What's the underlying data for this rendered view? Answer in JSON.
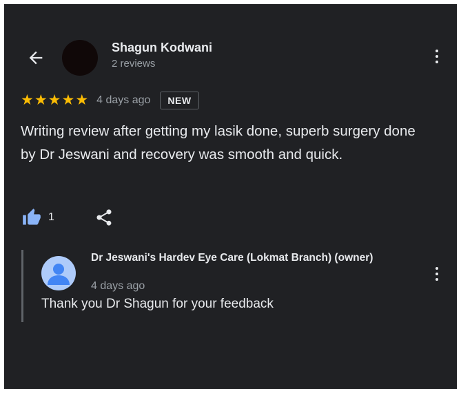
{
  "reviewer": {
    "name": "Shagun Kodwani",
    "meta": "2 reviews"
  },
  "review": {
    "rating": 5,
    "date": "4 days ago",
    "badge": "NEW",
    "text": "Writing review after getting my lasik done, superb surgery done by Dr Jeswani and recovery was smooth and quick.",
    "likes": "1"
  },
  "owner_response": {
    "name": "Dr Jeswani's Hardev Eye Care (Lokmat Branch) (owner)",
    "date": "4 days ago",
    "text": "Thank you Dr Shagun for your feedback"
  },
  "icons": {
    "back": "arrow-back-icon",
    "menu": "more-vert-icon",
    "like": "thumb-up-icon",
    "share": "share-icon",
    "star": "star-icon"
  },
  "colors": {
    "background": "#202124",
    "text_primary": "#e8eaed",
    "text_secondary": "#9aa0a6",
    "star": "#fbbc04",
    "like": "#8ab4f8",
    "owner_avatar": "#aecbfa"
  }
}
